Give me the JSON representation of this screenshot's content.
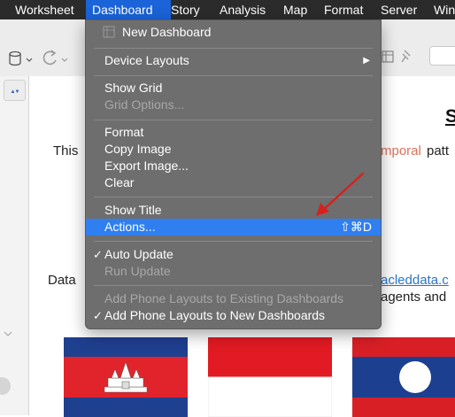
{
  "menubar": {
    "items": [
      "Worksheet",
      "Dashboard",
      "Story",
      "Analysis",
      "Map",
      "Format",
      "Server",
      "Win"
    ]
  },
  "dashboard_menu": {
    "items": [
      {
        "label": "New Dashboard",
        "enabled": true
      },
      {
        "label": "Device Layouts",
        "enabled": true,
        "submenu": "▶"
      },
      {
        "label": "Show Grid",
        "enabled": true
      },
      {
        "label": "Grid Options...",
        "enabled": false
      },
      {
        "label": "Format",
        "enabled": true
      },
      {
        "label": "Copy Image",
        "enabled": true
      },
      {
        "label": "Export Image...",
        "enabled": true
      },
      {
        "label": "Clear",
        "enabled": true
      },
      {
        "label": "Show Title",
        "enabled": true
      },
      {
        "label": "Actions...",
        "enabled": true,
        "shortcut": "⇧⌘D",
        "highlighted": true
      },
      {
        "label": "Auto Update",
        "enabled": true,
        "checked": true
      },
      {
        "label": "Run Update",
        "enabled": false
      },
      {
        "label": "Add Phone Layouts to Existing Dashboards",
        "enabled": false
      },
      {
        "label": "Add Phone Layouts to New Dashboards",
        "enabled": true,
        "checked": true
      }
    ],
    "check_glyph": "✓"
  },
  "content": {
    "heading": "S",
    "line1_start": "This",
    "line1_red": "mporal",
    "line1_end": "patt",
    "line2_start": "Data",
    "line2_link": "acleddata.c",
    "line3_end": "agents and"
  },
  "left_pane": {
    "tab_glyph": "▲▼"
  },
  "colors": {
    "menubar_bg": "#2b2b2b",
    "menu_bg": "#6e6e6e",
    "highlight": "#2f7ff0",
    "annotation_arrow": "#d62020"
  }
}
